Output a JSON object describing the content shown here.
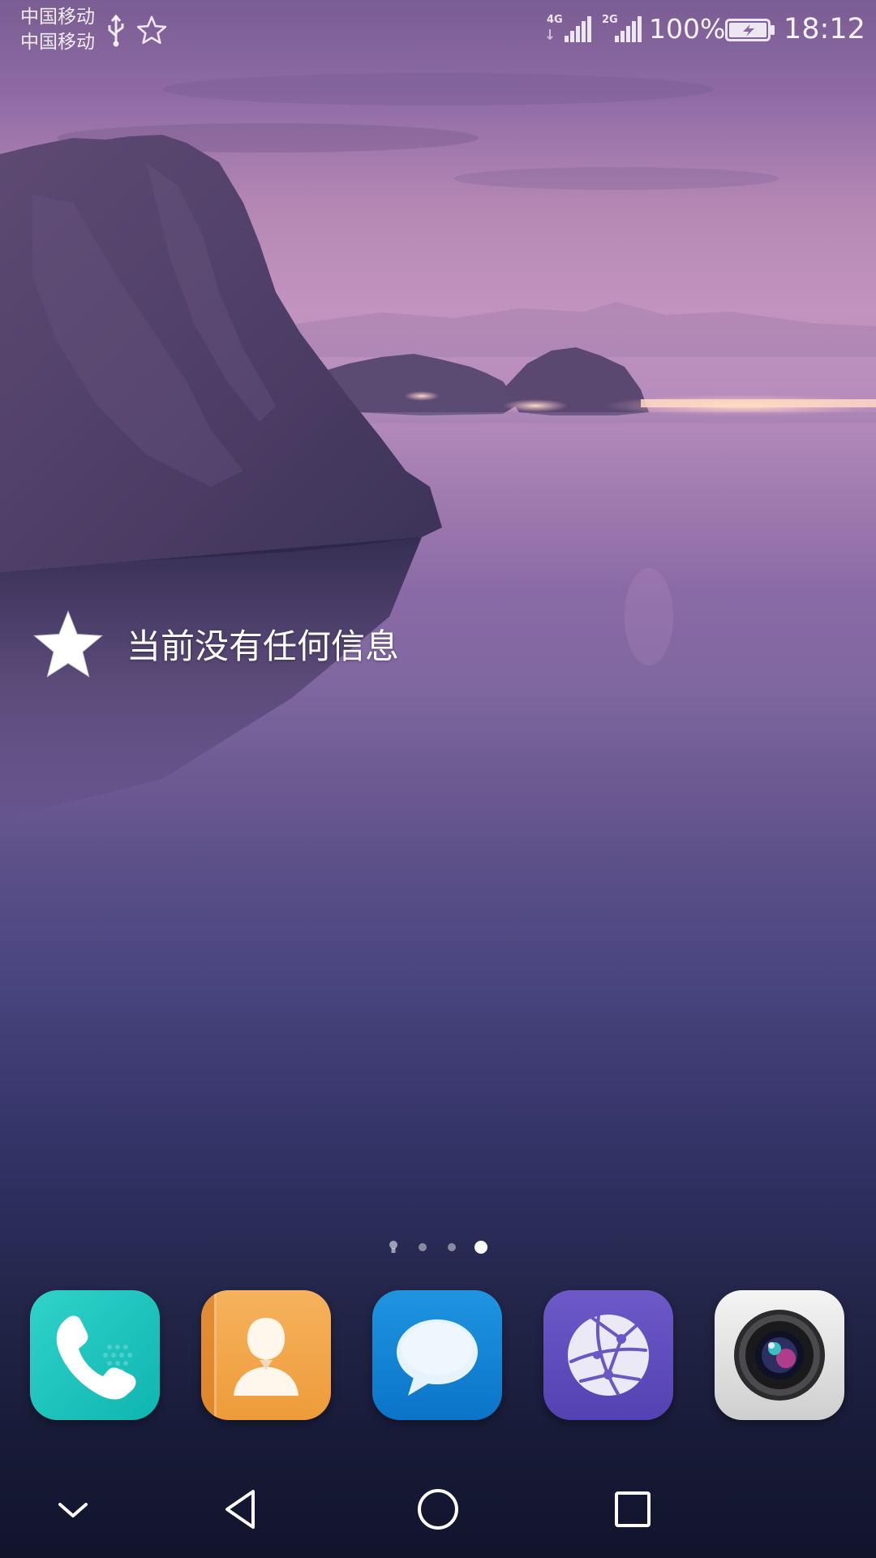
{
  "status_bar": {
    "carrier_1": "中国移动",
    "carrier_2": "中国移动",
    "sim1_network": "4G",
    "sim2_network": "2G",
    "battery_percent": "100%",
    "time": "18:12",
    "icons": [
      "usb-icon",
      "star-outline-icon",
      "signal-4g-icon",
      "signal-2g-icon",
      "battery-charging-icon"
    ]
  },
  "widget": {
    "icon": "star-icon",
    "message": "当前没有任何信息"
  },
  "page_indicator": {
    "page_count": 4,
    "active_page": 4
  },
  "dock": {
    "apps": [
      {
        "name": "phone",
        "icon": "phone-icon",
        "color": "#1cc3bd"
      },
      {
        "name": "contacts",
        "icon": "contacts-icon",
        "color": "#f2a64a"
      },
      {
        "name": "messages",
        "icon": "messages-icon",
        "color": "#1585d6"
      },
      {
        "name": "browser",
        "icon": "browser-icon",
        "color": "#5f4dbf"
      },
      {
        "name": "camera",
        "icon": "camera-icon",
        "color": "#e2e2e2"
      }
    ]
  },
  "nav_bar": {
    "buttons": [
      "hide-nav-icon",
      "back-icon",
      "home-icon",
      "recents-icon"
    ]
  }
}
